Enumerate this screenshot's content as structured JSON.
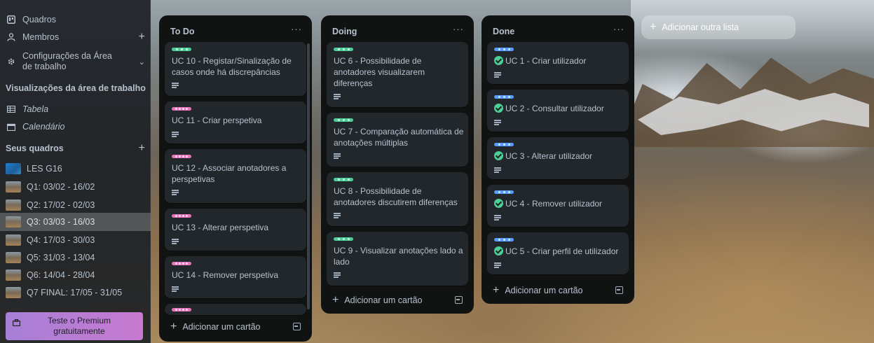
{
  "sidebar": {
    "quadros": "Quadros",
    "membros": "Membros",
    "config": "Configurações da Área de trabalho",
    "views_heading": "Visualizações da área de trabalho",
    "tabela": "Tabela",
    "calendario": "Calendário",
    "seus_quadros": "Seus quadros",
    "boards": [
      {
        "label": "LES G16",
        "active": false
      },
      {
        "label": "Q1: 03/02 - 16/02",
        "active": false
      },
      {
        "label": "Q2: 17/02 - 02/03",
        "active": false
      },
      {
        "label": "Q3: 03/03 - 16/03",
        "active": true
      },
      {
        "label": "Q4: 17/03 - 30/03",
        "active": false
      },
      {
        "label": "Q5: 31/03 - 13/04",
        "active": false
      },
      {
        "label": "Q6: 14/04 - 28/04",
        "active": false
      },
      {
        "label": "Q7 FINAL: 17/05 - 31/05",
        "active": false
      }
    ],
    "premium": "Teste o Premium gratuitamente"
  },
  "lists": [
    {
      "title": "To Do",
      "menu": "···",
      "cards": [
        {
          "label": "green",
          "title": "UC 10 - Registar/Sinalização de casos onde há discrepâncias"
        },
        {
          "label": "pink",
          "title": "UC 11 - Criar perspetiva"
        },
        {
          "label": "pink",
          "title": "UC 12 - Associar anotadores a perspetivas"
        },
        {
          "label": "pink",
          "title": "UC 13 - Alterar perspetiva"
        },
        {
          "label": "pink",
          "title": "UC 14 - Remover perspetiva"
        },
        {
          "label": "pink",
          "title": ""
        }
      ],
      "add_card": "Adicionar um cartão"
    },
    {
      "title": "Doing",
      "menu": "···",
      "cards": [
        {
          "label": "green",
          "title": "UC 6 - Possibilidade de anotadores visualizarem diferenças"
        },
        {
          "label": "green",
          "title": "UC 7 - Comparação automática de anotações múltiplas"
        },
        {
          "label": "green",
          "title": "UC 8 - Possibilidade de anotadores discutirem diferenças"
        },
        {
          "label": "green",
          "title": "UC 9 - Visualizar anotações lado a lado"
        }
      ],
      "add_card": "Adicionar um cartão"
    },
    {
      "title": "Done",
      "menu": "···",
      "cards": [
        {
          "label": "blue",
          "title": "UC 1 - Criar utilizador"
        },
        {
          "label": "blue",
          "title": "UC 2 - Consultar utilizador"
        },
        {
          "label": "blue",
          "title": "UC 3 - Alterar utilizador"
        },
        {
          "label": "blue",
          "title": "UC 4 - Remover utilizador"
        },
        {
          "label": "blue",
          "title": "UC 5 - Criar perfil de utilizador"
        }
      ],
      "add_card": "Adicionar um cartão"
    }
  ],
  "add_list": "Adicionar outra lista",
  "colors": {
    "label_green": "#4bce97",
    "label_pink": "#e774bb",
    "label_blue": "#579dff",
    "list_bg": "#111312",
    "card_bg": "#22272b"
  }
}
